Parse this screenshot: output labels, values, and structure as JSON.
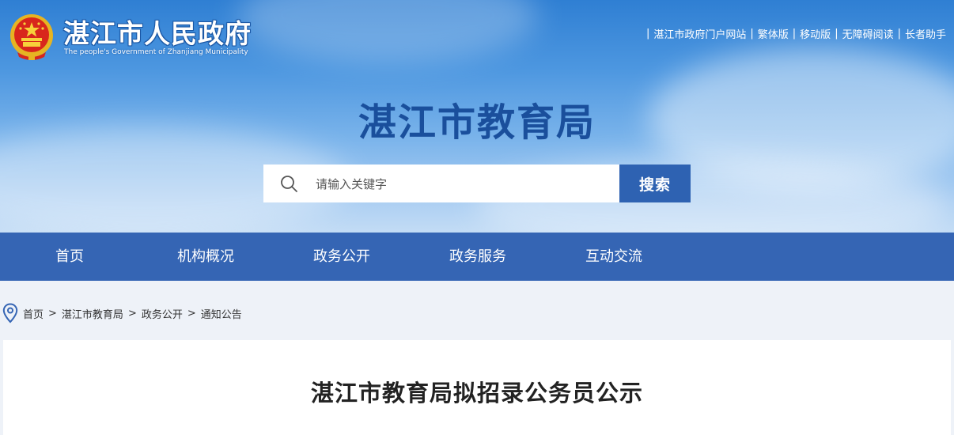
{
  "site": {
    "gov_name": "湛江市人民政府",
    "gov_name_en": "The people's Government of Zhanjiang Municipality",
    "title": "湛江市教育局"
  },
  "toplinks": [
    "湛江市政府门户网站",
    "繁体版",
    "移动版",
    "无障碍阅读",
    "长者助手"
  ],
  "search": {
    "placeholder": "请输入关键字",
    "button": "搜索"
  },
  "nav": [
    "首页",
    "机构概况",
    "政务公开",
    "政务服务",
    "互动交流"
  ],
  "breadcrumb": [
    "首页",
    "湛江市教育局",
    "政务公开",
    "通知公告"
  ],
  "article": {
    "title": "湛江市教育局拟招录公务员公示"
  },
  "colors": {
    "nav_bg": "#3565b4",
    "title_blue": "#1a4f9c",
    "search_button": "#2e62b2",
    "page_bg": "#eef2f8"
  },
  "icons": {
    "emblem": "national-emblem-icon",
    "search": "search-icon",
    "location": "location-pin-icon"
  }
}
